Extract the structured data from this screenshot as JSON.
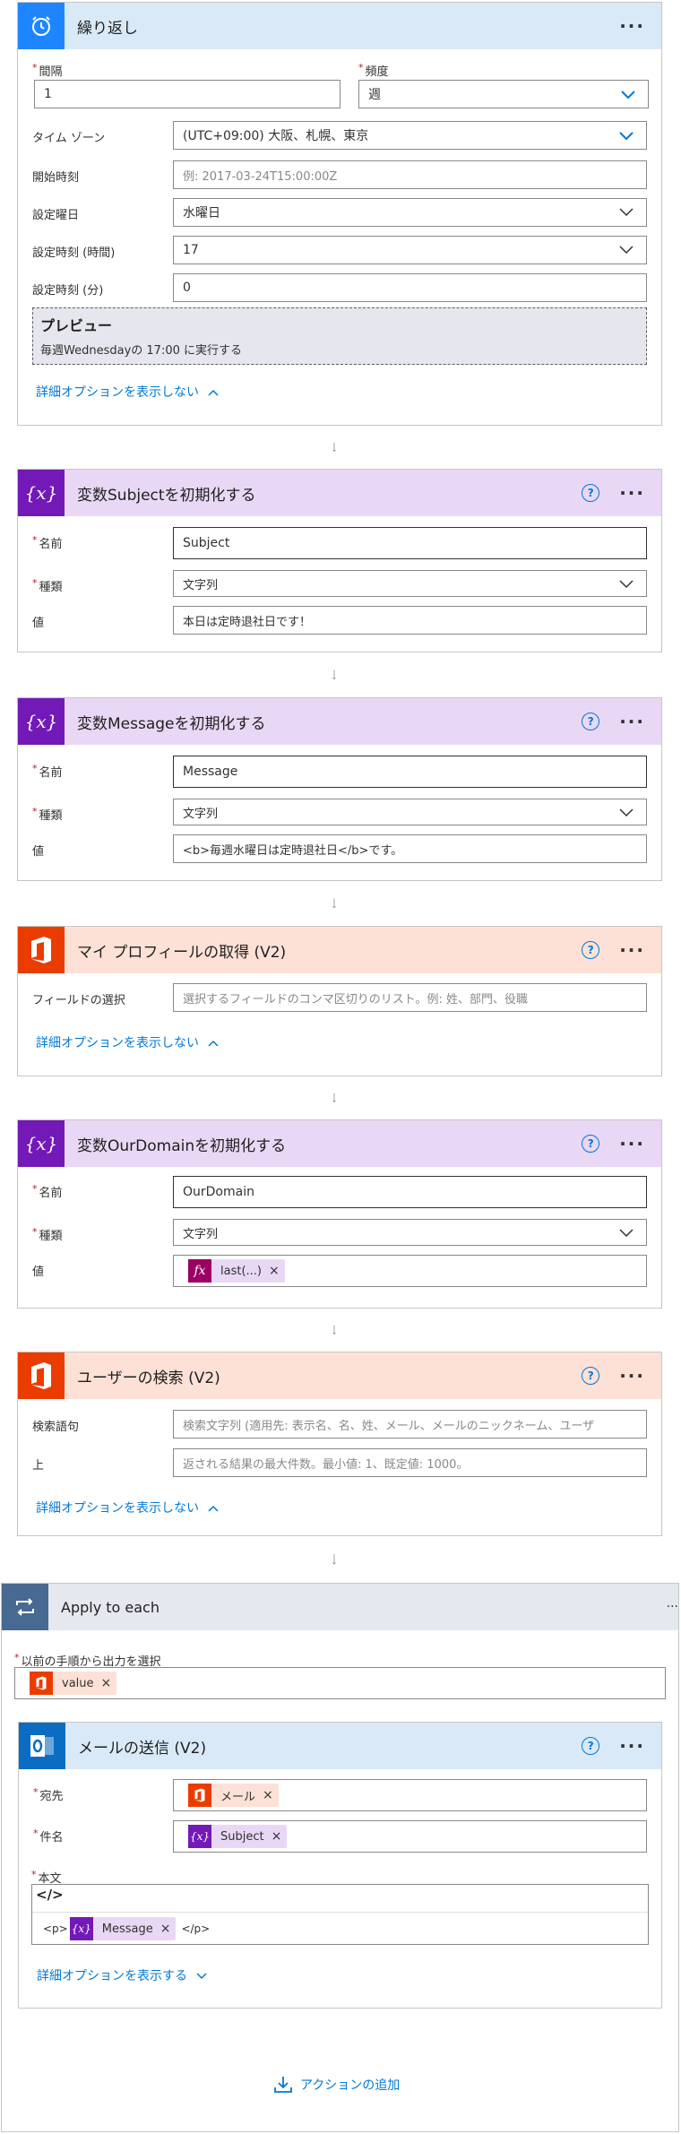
{
  "recurrence": {
    "title": "繰り返し",
    "interval_label": "間隔",
    "interval_value": "1",
    "frequency_label": "頻度",
    "frequency_value": "週",
    "timezone_label": "タイム ゾーン",
    "timezone_value": "(UTC+09:00) 大阪、札幌、東京",
    "start_label": "開始時刻",
    "start_placeholder": "例: 2017-03-24T15:00:00Z",
    "weekday_label": "設定曜日",
    "weekday_value": "水曜日",
    "hour_label": "設定時刻 (時間)",
    "hour_value": "17",
    "minute_label": "設定時刻 (分)",
    "minute_value": "0",
    "preview_title": "プレビュー",
    "preview_text": "毎週Wednesdayの 17:00 に実行する",
    "advanced_hide": "詳細オプションを表示しない"
  },
  "init_subject": {
    "title": "変数Subjectを初期化する",
    "name_label": "名前",
    "name_value": "Subject",
    "type_label": "種類",
    "type_value": "文字列",
    "value_label": "値",
    "value_value": "本日は定時退社日です！"
  },
  "init_message": {
    "title": "変数Messageを初期化する",
    "name_label": "名前",
    "name_value": "Message",
    "type_label": "種類",
    "type_value": "文字列",
    "value_label": "値",
    "value_value": "<b>毎週水曜日は定時退社日</b>です。"
  },
  "my_profile": {
    "title": "マイ プロフィールの取得 (V2)",
    "field_label": "フィールドの選択",
    "field_placeholder": "選択するフィールドのコンマ区切りのリスト。例: 姓、部門、役職",
    "advanced_hide": "詳細オプションを表示しない"
  },
  "init_domain": {
    "title": "変数OurDomainを初期化する",
    "name_label": "名前",
    "name_value": "OurDomain",
    "type_label": "種類",
    "type_value": "文字列",
    "value_label": "値",
    "token_label": "last(...)"
  },
  "search_user": {
    "title": "ユーザーの検索 (V2)",
    "term_label": "検索語句",
    "term_placeholder": "検索文字列 (適用先: 表示名、名、姓、メール、メールのニックネーム、ユーザ",
    "top_label": "上",
    "top_placeholder": "返される結果の最大件数。最小値: 1、既定値: 1000。",
    "advanced_hide": "詳細オプションを表示しない"
  },
  "apply_each": {
    "title": "Apply to each",
    "select_label": "以前の手順から出力を選択",
    "token_label": "value"
  },
  "send_mail": {
    "title": "メールの送信 (V2)",
    "to_label": "宛先",
    "to_token": "メール",
    "subject_label": "件名",
    "subject_token": "Subject",
    "body_label": "本文",
    "code_view": "</>",
    "p_open": "<p>",
    "body_token": "Message",
    "p_close": "</p>",
    "advanced_show": "詳細オプションを表示する"
  },
  "add_action": "アクションの追加",
  "help_glyph": "?",
  "more_glyph": "···",
  "remove_glyph": "×",
  "colors": {
    "accent": "#0078d4",
    "purple": "#7319b8",
    "orange": "#eb3c00",
    "red": "#a4262c",
    "loop": "#486991"
  }
}
